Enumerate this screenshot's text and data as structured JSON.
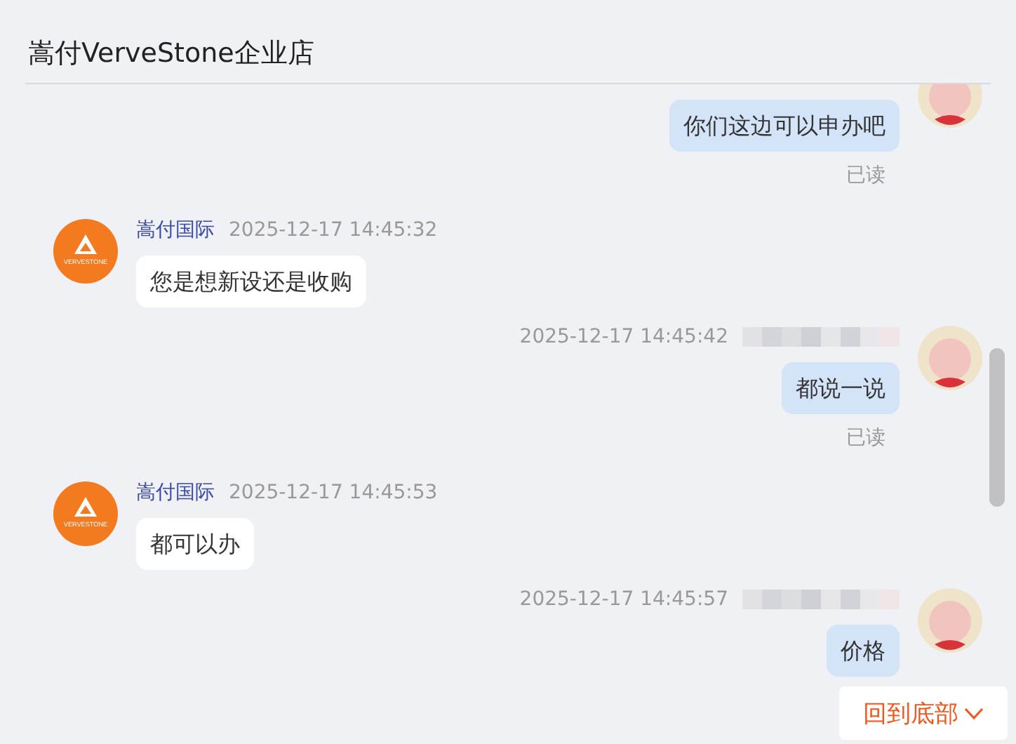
{
  "header": {
    "title": "嵩付VerveStone企业店"
  },
  "messages": [
    {
      "kind": "outgoing",
      "text": "你们这边可以申办吧",
      "read_mark": "已读"
    },
    {
      "kind": "incoming",
      "sender": "嵩付国际",
      "time": "2025-12-17 14:45:32",
      "logo_text": "VERVESTONE",
      "text": "您是想新设还是收购"
    },
    {
      "kind": "outgoing",
      "time": "2025-12-17 14:45:42",
      "name_blurred": true,
      "text": "都说一说",
      "read_mark": "已读"
    },
    {
      "kind": "incoming",
      "sender": "嵩付国际",
      "time": "2025-12-17 14:45:53",
      "logo_text": "VERVESTONE",
      "text": "都可以办"
    },
    {
      "kind": "outgoing",
      "time": "2025-12-17 14:45:57",
      "name_blurred": true,
      "text": "价格"
    }
  ],
  "back_to_bottom": {
    "label": "回到底部"
  }
}
